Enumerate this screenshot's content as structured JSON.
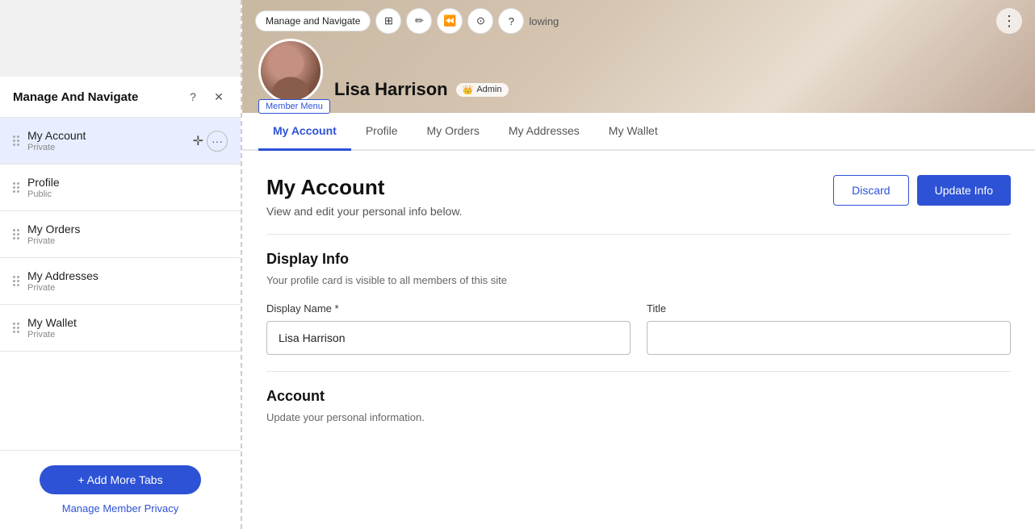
{
  "leftPanel": {
    "header": {
      "title": "Manage And Navigate",
      "helpIcon": "?",
      "closeIcon": "✕"
    },
    "navItems": [
      {
        "id": "my-account",
        "name": "My Account",
        "visibility": "Private",
        "active": true
      },
      {
        "id": "profile",
        "name": "Profile",
        "visibility": "Public",
        "active": false
      },
      {
        "id": "my-orders",
        "name": "My Orders",
        "visibility": "Private",
        "active": false
      },
      {
        "id": "my-addresses",
        "name": "My Addresses",
        "visibility": "Private",
        "active": false
      },
      {
        "id": "my-wallet",
        "name": "My Wallet",
        "visibility": "Private",
        "active": false
      }
    ],
    "footer": {
      "addTabsLabel": "+ Add More Tabs",
      "managePrivacyLabel": "Manage Member Privacy"
    }
  },
  "banner": {
    "profileName": "Lisa Harrison",
    "adminBadge": "Admin",
    "toolbarLabel": "Manage and Navigate",
    "memberMenuLabel": "Member Menu",
    "moreIcon": "⋮"
  },
  "tabs": [
    {
      "id": "my-account",
      "label": "My Account",
      "active": true
    },
    {
      "id": "profile",
      "label": "Profile",
      "active": false
    },
    {
      "id": "my-orders",
      "label": "My Orders",
      "active": false
    },
    {
      "id": "my-addresses",
      "label": "My Addresses",
      "active": false
    },
    {
      "id": "my-wallet",
      "label": "My Wallet",
      "active": false
    }
  ],
  "mainContent": {
    "title": "My Account",
    "subtitle": "View and edit your personal info below.",
    "discardLabel": "Discard",
    "updateLabel": "Update Info",
    "displayInfo": {
      "sectionTitle": "Display Info",
      "sectionDesc": "Your profile card is visible to all members of this site",
      "displayNameLabel": "Display Name *",
      "displayNameValue": "Lisa Harrison",
      "titleLabel": "Title",
      "titleValue": ""
    },
    "account": {
      "sectionTitle": "Account",
      "sectionDesc": "Update your personal information."
    }
  }
}
